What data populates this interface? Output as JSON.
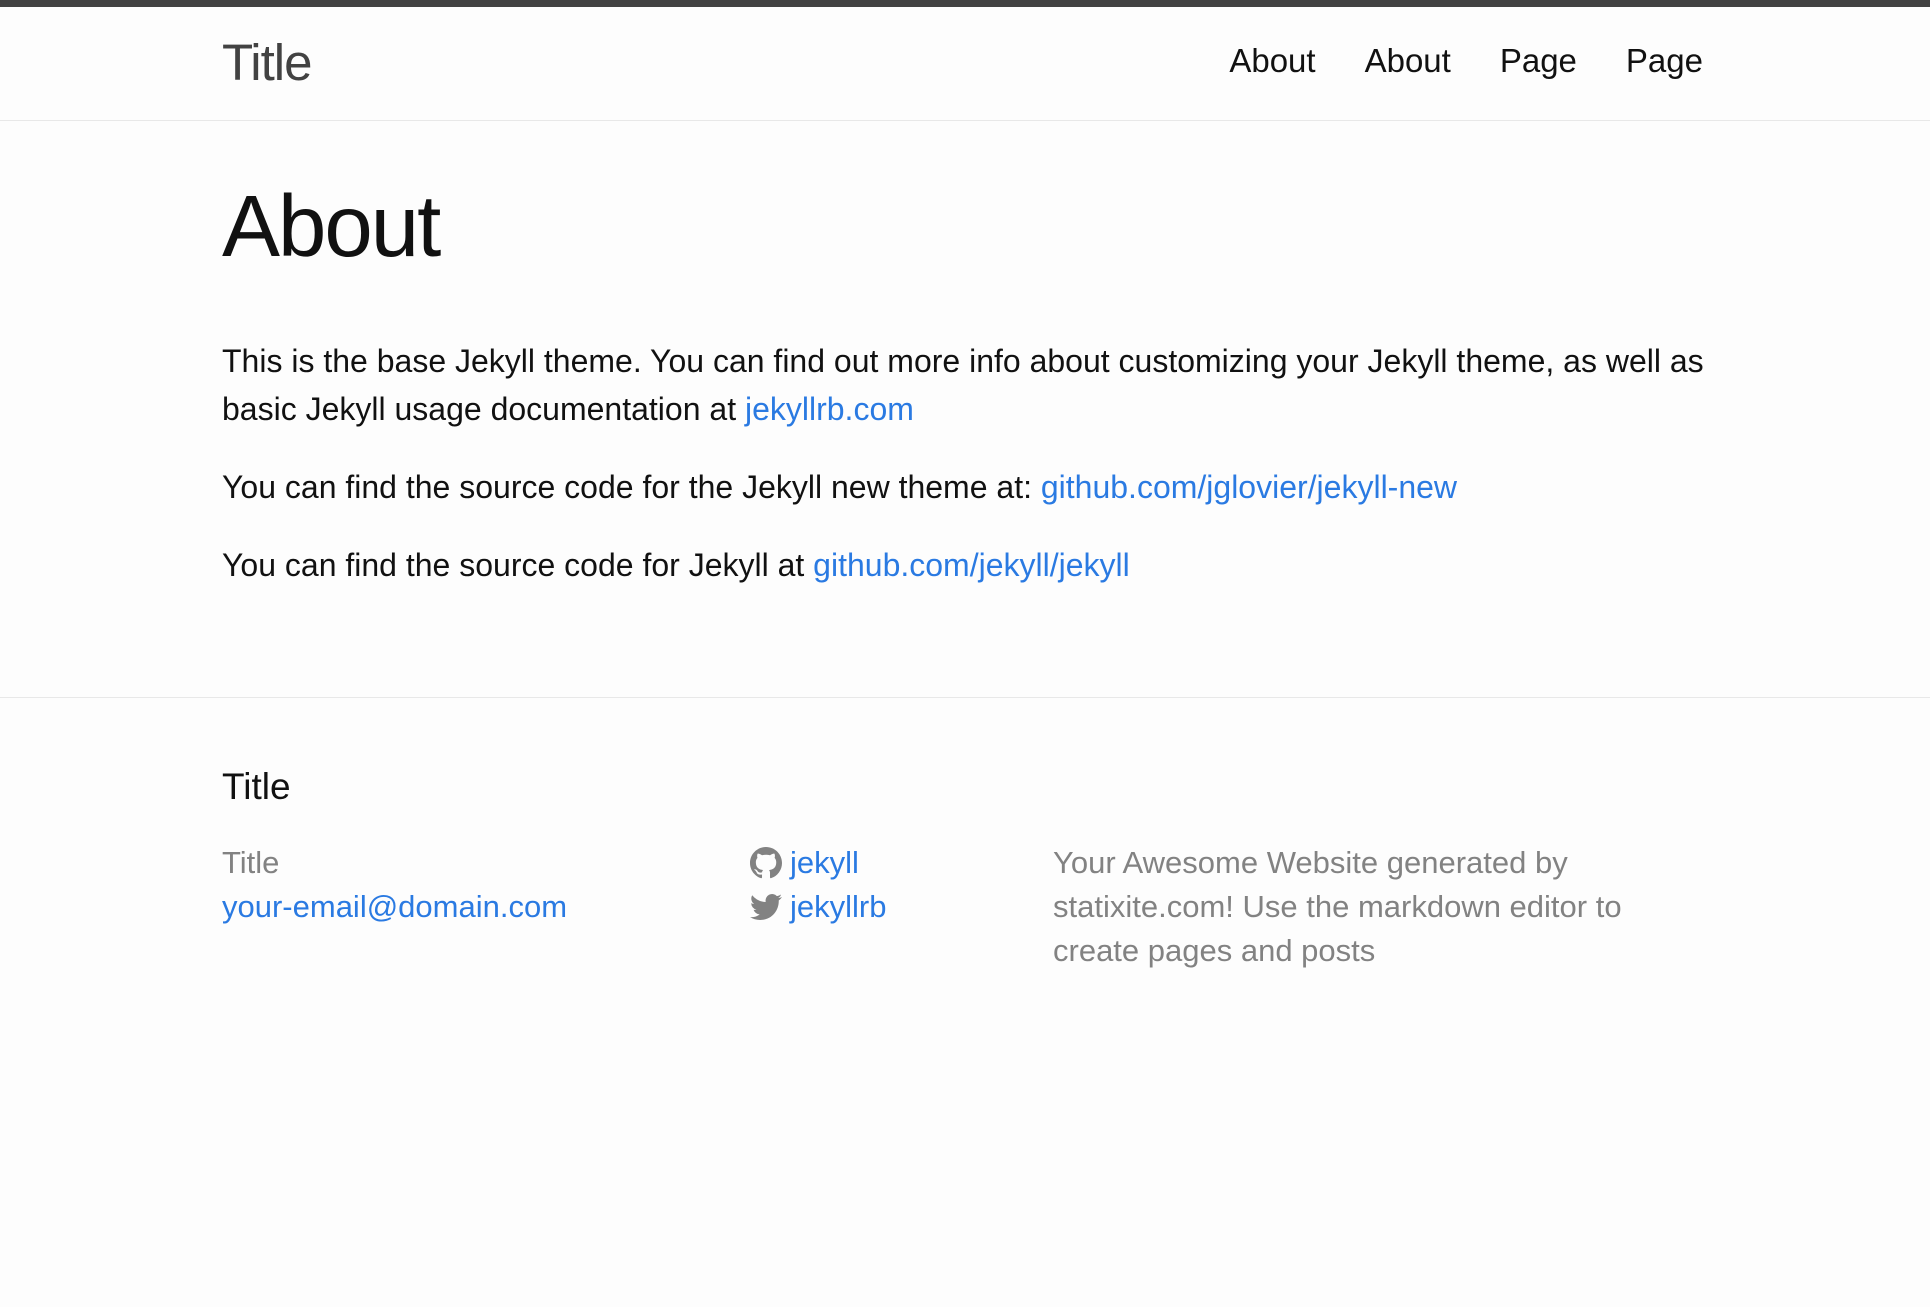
{
  "header": {
    "site_title": "Title",
    "nav": [
      {
        "label": "About"
      },
      {
        "label": "About"
      },
      {
        "label": "Page"
      },
      {
        "label": "Page"
      }
    ]
  },
  "main": {
    "title": "About",
    "p1_text": "This is the base Jekyll theme. You can find out more info about customizing your Jekyll theme, as well as basic Jekyll usage documentation at ",
    "p1_link": "jekyllrb.com",
    "p2_text": "You can find the source code for the Jekyll new theme at: ",
    "p2_link": "github.com/jglovier/jekyll-new",
    "p3_text": "You can find the source code for Jekyll at ",
    "p3_link": "github.com/jekyll/jekyll"
  },
  "footer": {
    "heading": "Title",
    "name": "Title",
    "email": "your-email@domain.com",
    "github": {
      "icon": "github-icon",
      "label": "jekyll"
    },
    "twitter": {
      "icon": "twitter-icon",
      "label": "jekyllrb"
    },
    "description": "Your Awesome Website generated by statixite.com! Use the markdown editor to create pages and posts"
  },
  "colors": {
    "link": "#2a7ae2",
    "text": "#111111",
    "muted": "#828282",
    "top_bar": "#424242",
    "border": "#e8e8e8"
  }
}
